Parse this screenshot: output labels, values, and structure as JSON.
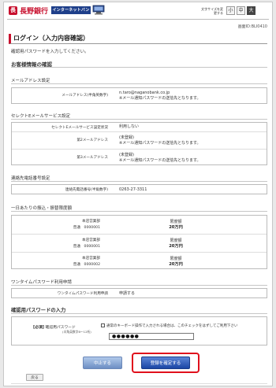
{
  "header": {
    "bank_name": "長野銀行",
    "logo_char": "長",
    "ib_banner": "インターネットバンキング",
    "font_size_label": "文字サイズを変更する",
    "font_sizes": [
      "小",
      "中",
      "大"
    ]
  },
  "screen_id": "画面ID:BLI0410",
  "page_title": "ログイン（入力内容確認）",
  "instruction": "確認用パスワードを入力してください。",
  "customer_section": {
    "title": "お客様情報の確認",
    "email": {
      "title": "メールアドレス設定",
      "label": "メールアドレス(半角英数字)",
      "value": "n.taro@naganobank.co.jp",
      "note": "※メール通知パスワードの送信先となります。"
    },
    "select_e": {
      "title": "セレクトEメールサービス設定",
      "rows": [
        {
          "label": "セレクトEメールサービス設定状況",
          "value": "利用しない",
          "note": ""
        },
        {
          "label": "第2メールアドレス",
          "value": "(未登録)",
          "note": "※メール通知パスワードの送信先となります。"
        },
        {
          "label": "第3メールアドレス",
          "value": "(未登録)",
          "note": "※メール通知パスワードの送信先となります。"
        }
      ]
    },
    "phone": {
      "title": "連絡先電話番号設定",
      "label": "連絡先電話番号(半角数字)",
      "value": "0263-27-3311"
    },
    "limits": {
      "title": "一日あたりの振込・振替限度額",
      "header": "限度額",
      "rows": [
        {
          "branch": "本店営業部",
          "type": "普通",
          "number": "0000001",
          "limit": "20万円"
        },
        {
          "branch": "本店営業部",
          "type": "普通",
          "number": "0000001",
          "limit": "20万円"
        },
        {
          "branch": "本店営業部",
          "type": "普通",
          "number": "0000002",
          "limit": "20万円"
        }
      ]
    },
    "onetime": {
      "title": "ワンタイムパスワード利用申請",
      "label": "ワンタイムパスワード利用申請",
      "value": "申請する"
    }
  },
  "confirm_password": {
    "title": "確認用パスワードの入力",
    "required": "[必須]",
    "label": "確認用パスワード",
    "label_sub": "(半角英数字6〜12桁)",
    "checkbox_note": "通常のキーボード操作で入力される場合は、このチェックをはずしてご利用下さい",
    "value": "●●●●●●"
  },
  "buttons": {
    "cancel": "中止する",
    "confirm": "登録を確定する",
    "back": "戻る"
  },
  "colors": {
    "brand_red": "#c8102e",
    "confirm_blue": "#1b46a5",
    "highlight_red": "#e0101c"
  }
}
